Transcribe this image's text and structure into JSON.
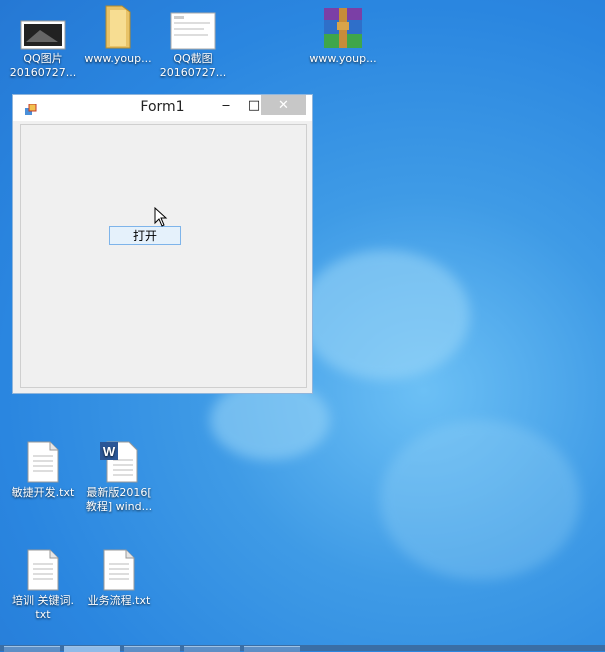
{
  "desktop": {
    "icons": [
      {
        "name": "qq-image-icon",
        "label1": "QQ图片",
        "label2": "20160727..."
      },
      {
        "name": "folder-icon",
        "label1": "www.youp...",
        "label2": ""
      },
      {
        "name": "qq-screenshot-icon",
        "label1": "QQ截图",
        "label2": "20160727..."
      },
      {
        "name": "winrar-archive-icon",
        "label1": "www.youp...",
        "label2": ""
      },
      {
        "name": "text-file-icon",
        "label1": "敏捷开发.txt",
        "label2": ""
      },
      {
        "name": "word-document-icon",
        "label1": "最新版2016[",
        "label2": "教程] wind..."
      },
      {
        "name": "text-file-icon",
        "label1": "培训 关键词.",
        "label2": "txt"
      },
      {
        "name": "text-file-icon",
        "label1": "业务流程.txt",
        "label2": ""
      }
    ]
  },
  "form": {
    "title": "Form1",
    "minimize": "‒",
    "maximize": "□",
    "close": "✕",
    "button_label": "打开"
  }
}
